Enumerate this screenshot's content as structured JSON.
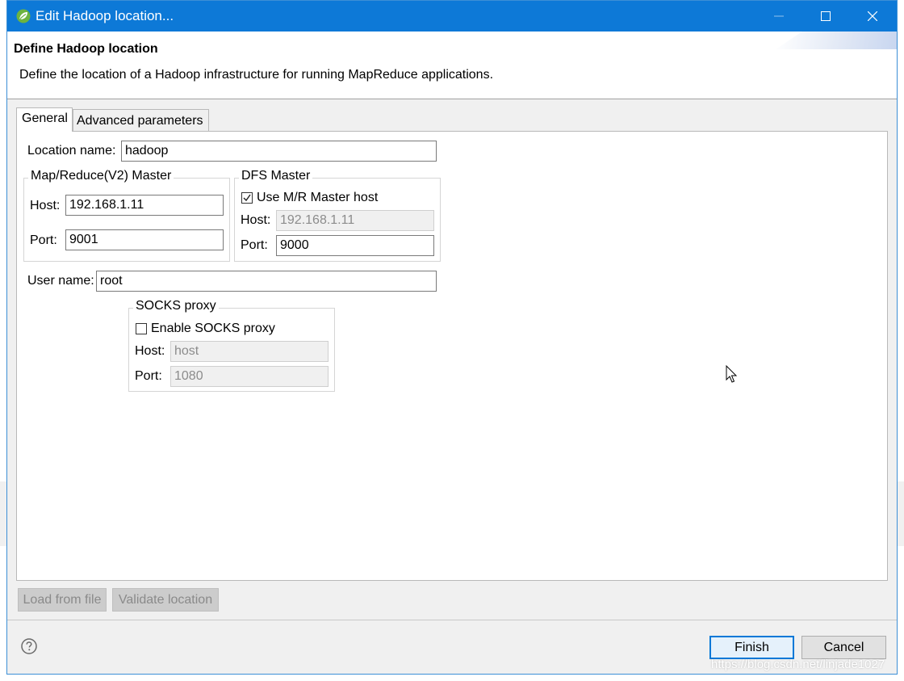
{
  "window": {
    "title": "Edit Hadoop location..."
  },
  "header": {
    "title": "Define Hadoop location",
    "description": "Define the location of a Hadoop infrastructure for running MapReduce applications."
  },
  "tabs": [
    {
      "label": "General",
      "selected": true
    },
    {
      "label": "Advanced parameters",
      "selected": false
    }
  ],
  "general": {
    "location_name_label": "Location name:",
    "location_name_value": "hadoop",
    "mr_master": {
      "title": "Map/Reduce(V2) Master",
      "host_label": "Host:",
      "host_value": "192.168.1.11",
      "port_label": "Port:",
      "port_value": "9001"
    },
    "dfs_master": {
      "title": "DFS Master",
      "use_mr_host_label": "Use M/R Master host",
      "use_mr_host_checked": true,
      "host_label": "Host:",
      "host_value": "192.168.1.11",
      "port_label": "Port:",
      "port_value": "9000"
    },
    "user_name_label": "User name:",
    "user_name_value": "root",
    "socks": {
      "title": "SOCKS proxy",
      "enable_label": "Enable SOCKS proxy",
      "enable_checked": false,
      "host_label": "Host:",
      "host_value": "host",
      "port_label": "Port:",
      "port_value": "1080"
    }
  },
  "panel_buttons": {
    "load_from_file": "Load from file",
    "validate_location": "Validate location"
  },
  "footer": {
    "finish": "Finish",
    "cancel": "Cancel"
  },
  "watermark": "https://blog.csdn.net/linjade1027",
  "colors": {
    "titlebar": "#0d79d7",
    "default_button_border": "#0078d7"
  },
  "icons": {
    "app": "spring-leaf-icon",
    "help": "question-mark-icon"
  }
}
